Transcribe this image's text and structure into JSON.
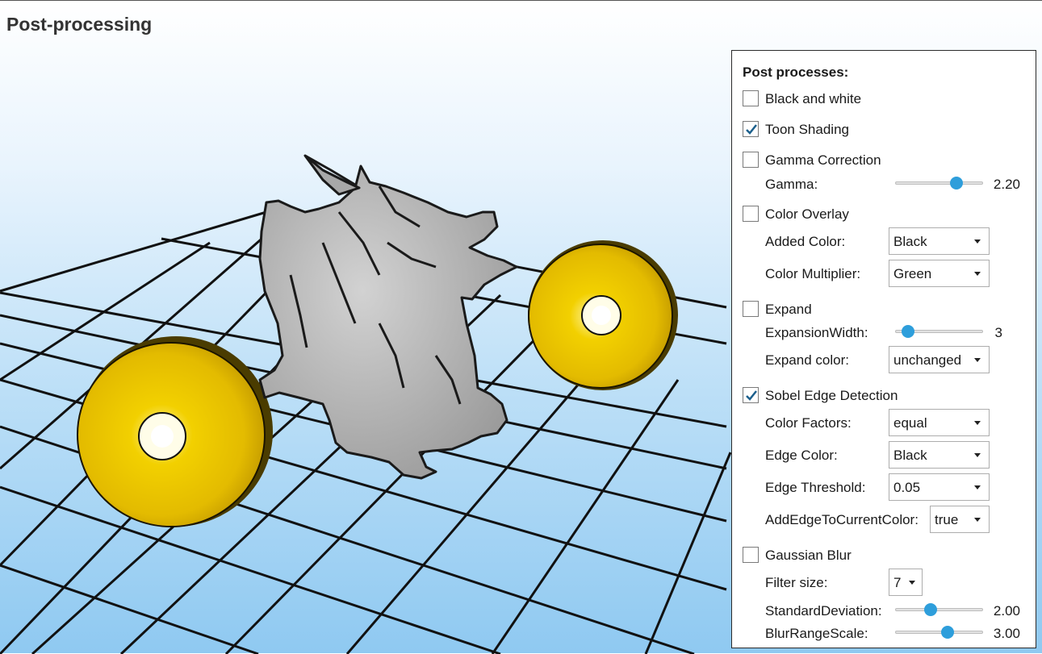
{
  "window": {
    "title": "Post-processing"
  },
  "panel": {
    "heading": "Post processes:",
    "black_and_white": {
      "label": "Black and white",
      "checked": false
    },
    "toon_shading": {
      "label": "Toon Shading",
      "checked": true
    },
    "gamma_correction": {
      "label": "Gamma Correction",
      "checked": false,
      "gamma_label": "Gamma:",
      "gamma_value": "2.20",
      "gamma_fraction": 0.7
    },
    "color_overlay": {
      "label": "Color Overlay",
      "checked": false,
      "added_color_label": "Added Color:",
      "added_color_value": "Black",
      "color_multiplier_label": "Color Multiplier:",
      "color_multiplier_value": "Green"
    },
    "expand": {
      "label": "Expand",
      "checked": false,
      "width_label": "ExpansionWidth:",
      "width_value": "3",
      "width_fraction": 0.15,
      "color_label": "Expand color:",
      "color_value": "unchanged"
    },
    "sobel": {
      "label": "Sobel Edge Detection",
      "checked": true,
      "color_factors_label": "Color Factors:",
      "color_factors_value": "equal",
      "edge_color_label": "Edge Color:",
      "edge_color_value": "Black",
      "edge_threshold_label": "Edge Threshold:",
      "edge_threshold_value": "0.05",
      "add_edge_label": "AddEdgeToCurrentColor:",
      "add_edge_value": "true"
    },
    "gaussian_blur": {
      "label": "Gaussian Blur",
      "checked": false,
      "filter_size_label": "Filter size:",
      "filter_size_value": "7",
      "std_dev_label": "StandardDeviation:",
      "std_dev_value": "2.00",
      "std_dev_fraction": 0.4,
      "blur_range_label": "BlurRangeScale:",
      "blur_range_value": "3.00",
      "blur_range_fraction": 0.6
    }
  },
  "colors": {
    "accent": "#2e9edb",
    "check": "#1b5f8c",
    "sphere": "#e8c000",
    "dragon": "#a8a8a8"
  },
  "icons": {
    "checkbox_checked": "check-mark-icon",
    "dropdown": "chevron-down-icon"
  }
}
